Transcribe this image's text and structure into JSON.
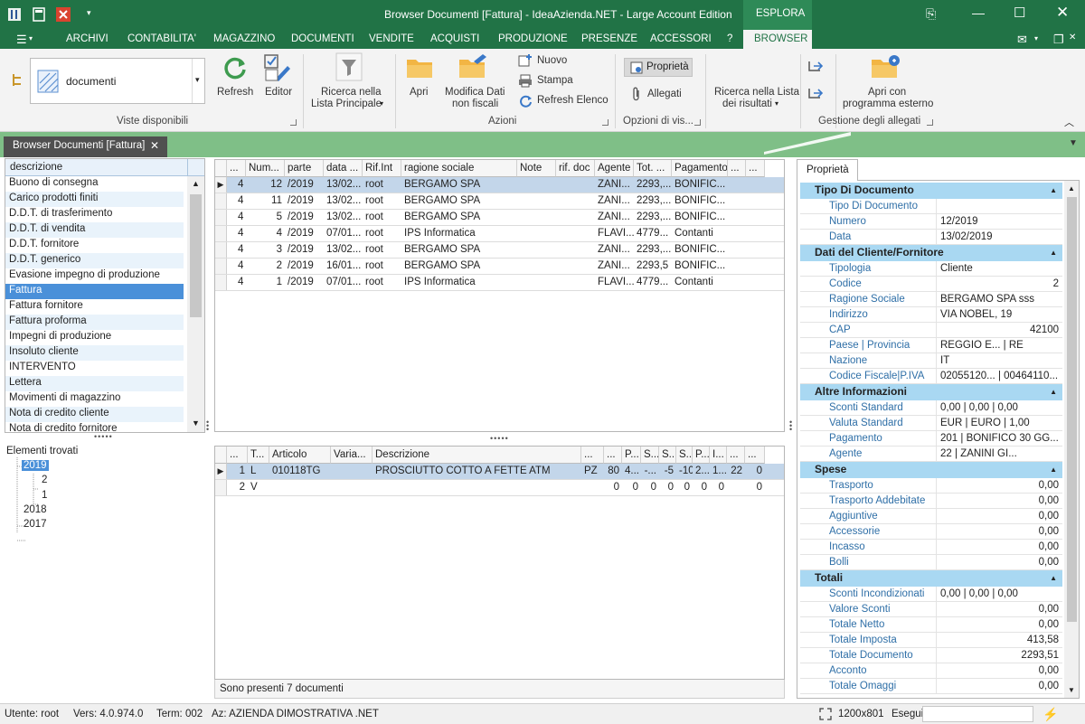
{
  "window": {
    "title": "Browser Documenti [Fattura] - IdeaAzienda.NET - Large Account Edition",
    "context_label": "ESPLORA"
  },
  "ribbon_tabs": [
    "ARCHIVI",
    "CONTABILITA'",
    "MAGAZZINO",
    "DOCUMENTI",
    "VENDITE",
    "ACQUISTI",
    "PRODUZIONE",
    "PRESENZE",
    "ACCESSORI",
    "?",
    "BROWSER"
  ],
  "ribbon": {
    "view_combo_value": "documenti",
    "refresh": "Refresh",
    "editor": "Editor",
    "group_viste": "Viste disponibili",
    "ricerca_principale_1": "Ricerca nella",
    "ricerca_principale_2": "Lista Principale",
    "apri": "Apri",
    "modifica_1": "Modifica Dati",
    "modifica_2": "non fiscali",
    "nuovo": "Nuovo",
    "stampa": "Stampa",
    "refresh_elenco": "Refresh Elenco",
    "group_azioni": "Azioni",
    "proprieta": "Proprietà",
    "allegati": "Allegati",
    "group_opzioni": "Opzioni di vis...",
    "ricerca_risultati_1": "Ricerca nella Lista",
    "ricerca_risultati_2": "dei risultati",
    "apri_esterno_1": "Apri con",
    "apri_esterno_2": "programma esterno",
    "group_allegati": "Gestione degli allegati"
  },
  "doc_tab": {
    "label": "Browser Documenti [Fattura]"
  },
  "doc_types": {
    "header": "descrizione",
    "items": [
      "Buono di consegna",
      "Carico prodotti finiti",
      "D.D.T. di trasferimento",
      "D.D.T. di vendita",
      "D.D.T. fornitore",
      "D.D.T. generico",
      "Evasione impegno di produzione",
      "Fattura",
      "Fattura fornitore",
      "Fattura proforma",
      "Impegni di produzione",
      "Insoluto cliente",
      "INTERVENTO",
      "Lettera",
      "Movimenti di magazzino",
      "Nota di credito cliente",
      "Nota di credito fornitore"
    ],
    "selected_index": 7
  },
  "tree": {
    "label": "Elementi trovati",
    "year_selected": "2019",
    "child_1": "2",
    "child_2": "1",
    "year_2": "2018",
    "year_3": "2017"
  },
  "docs_grid": {
    "columns": [
      "...",
      "Num...",
      "parte",
      "data ...",
      "Rif.Int",
      "ragione sociale",
      "Note",
      "rif. doc",
      "Agente",
      "Tot. ...",
      "Pagamento",
      "...",
      "..."
    ],
    "rows": [
      {
        "c0": "4",
        "num": "12",
        "parte": "/2019",
        "data": "13/02...",
        "rif": "root",
        "rs": "BERGAMO SPA",
        "note": "",
        "rifdoc": "",
        "agente": "ZANI...",
        "tot": "2293,...",
        "pag": "BONIFIC..."
      },
      {
        "c0": "4",
        "num": "11",
        "parte": "/2019",
        "data": "13/02...",
        "rif": "root",
        "rs": "BERGAMO SPA",
        "note": "",
        "rifdoc": "",
        "agente": "ZANI...",
        "tot": "2293,...",
        "pag": "BONIFIC..."
      },
      {
        "c0": "4",
        "num": "5",
        "parte": "/2019",
        "data": "13/02...",
        "rif": "root",
        "rs": "BERGAMO SPA",
        "note": "",
        "rifdoc": "",
        "agente": "ZANI...",
        "tot": "2293,...",
        "pag": "BONIFIC..."
      },
      {
        "c0": "4",
        "num": "4",
        "parte": "/2019",
        "data": "07/01...",
        "rif": "root",
        "rs": "IPS Informatica",
        "note": "",
        "rifdoc": "",
        "agente": "FLAVI...",
        "tot": "4779...",
        "pag": "Contanti"
      },
      {
        "c0": "4",
        "num": "3",
        "parte": "/2019",
        "data": "13/02...",
        "rif": "root",
        "rs": "BERGAMO SPA",
        "note": "",
        "rifdoc": "",
        "agente": "ZANI...",
        "tot": "2293,...",
        "pag": "BONIFIC..."
      },
      {
        "c0": "4",
        "num": "2",
        "parte": "/2019",
        "data": "16/01...",
        "rif": "root",
        "rs": "BERGAMO SPA",
        "note": "",
        "rifdoc": "",
        "agente": "ZANI...",
        "tot": "2293,5",
        "pag": "BONIFIC..."
      },
      {
        "c0": "4",
        "num": "1",
        "parte": "/2019",
        "data": "07/01...",
        "rif": "root",
        "rs": "IPS Informatica",
        "note": "",
        "rifdoc": "",
        "agente": "FLAVI...",
        "tot": "4779...",
        "pag": "Contanti"
      }
    ]
  },
  "lines_grid": {
    "columns": [
      "...",
      "T...",
      "Articolo",
      "Varia...",
      "Descrizione",
      "...",
      "...",
      "P...",
      "S...",
      "S...",
      "S...",
      "P...",
      "I...",
      "...",
      "..."
    ],
    "rows": [
      [
        "1",
        "L",
        "010118TG",
        "",
        "PROSCIUTTO COTTO A FETTE ATM",
        "PZ",
        "80",
        "4...",
        "-...",
        "-5",
        "-10",
        "2...",
        "1...",
        "22",
        "0"
      ],
      [
        "2",
        "V",
        "",
        "",
        "",
        "",
        "0",
        "0",
        "0",
        "0",
        "0",
        "0",
        "0",
        "",
        "0"
      ]
    ],
    "footer": "Sono presenti 7 documenti"
  },
  "properties": {
    "tab": "Proprietà",
    "sections": [
      {
        "title": "Tipo Di Documento",
        "rows": [
          [
            "Tipo Di Documento",
            ""
          ],
          [
            "Numero",
            "12/2019"
          ],
          [
            "Data",
            "13/02/2019"
          ]
        ]
      },
      {
        "title": "Dati del Cliente/Fornitore",
        "rows": [
          [
            "Tipologia",
            "Cliente"
          ],
          [
            "Codice",
            "2"
          ],
          [
            "Ragione Sociale",
            "BERGAMO SPA sss"
          ],
          [
            "Indirizzo",
            "VIA NOBEL, 19"
          ],
          [
            "CAP",
            "42100"
          ],
          [
            "Paese | Provincia",
            "REGGIO E... | RE"
          ],
          [
            "Nazione",
            "IT"
          ],
          [
            "Codice Fiscale|P.IVA",
            "02055120... | 00464110..."
          ]
        ]
      },
      {
        "title": "Altre Informazioni",
        "rows": [
          [
            "Sconti Standard",
            "0,00 | 0,00 | 0,00"
          ],
          [
            "Valuta Standard",
            "EUR | EURO | 1,00"
          ],
          [
            "Pagamento",
            "201 | BONIFICO 30 GG..."
          ],
          [
            "Agente",
            "22 | ZANINI GI..."
          ]
        ]
      },
      {
        "title": "Spese",
        "rows": [
          [
            "Trasporto",
            "0,00"
          ],
          [
            "Trasporto Addebitate",
            "0,00"
          ],
          [
            "Aggiuntive",
            "0,00"
          ],
          [
            "Accessorie",
            "0,00"
          ],
          [
            "Incasso",
            "0,00"
          ],
          [
            "Bolli",
            "0,00"
          ]
        ]
      },
      {
        "title": "Totali",
        "rows": [
          [
            "Sconti Incondizionati",
            "0,00 | 0,00 | 0,00"
          ],
          [
            "Valore Sconti",
            "0,00"
          ],
          [
            "Totale Netto",
            "0,00"
          ],
          [
            "Totale Imposta",
            "413,58"
          ],
          [
            "Totale Documento",
            "2293,51"
          ],
          [
            "Acconto",
            "0,00"
          ],
          [
            "Totale Omaggi",
            "0,00"
          ]
        ]
      }
    ]
  },
  "status": {
    "utente": "Utente: root",
    "vers": "Vers: 4.0.974.0",
    "term": "Term: 002",
    "az": "Az: AZIENDA DIMOSTRATIVA .NET",
    "size": "1200x801",
    "esegui": "Esegui"
  },
  "colors": {
    "brand": "#217346",
    "selection": "#4a90d9",
    "section": "#a9d8f2",
    "doc_tab_bar": "#7fbf87"
  }
}
